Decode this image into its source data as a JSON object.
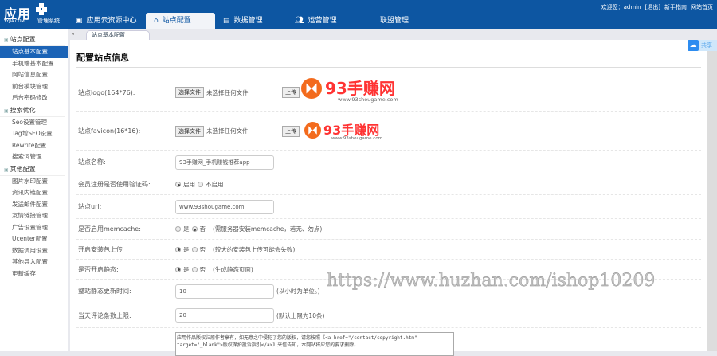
{
  "header": {
    "logo_main": "应用",
    "logo_sub": "YYJIA.COM",
    "logo_system": "管理系统",
    "nav": [
      {
        "label": "应用云资源中心",
        "icon": "window-icon"
      },
      {
        "label": "站点配置",
        "icon": "home-icon",
        "active": true
      },
      {
        "label": "数据管理",
        "icon": "table-icon"
      },
      {
        "label": "运营管理",
        "icon": "users-icon"
      },
      {
        "label": "联盟管理"
      }
    ],
    "welcome": "欢迎您：admin",
    "logout": "[退出]",
    "guide": "新手指南",
    "home": "网站首页"
  },
  "sidebar": {
    "groups": [
      {
        "title": "站点配置",
        "items": [
          "站点基本配置",
          "手机端基本配置",
          "网站信息配置",
          "前台模块管理",
          "后台密码修改"
        ]
      },
      {
        "title": "搜索优化",
        "items": [
          "Seo设置管理",
          "Tag增SEO设置",
          "Rewrite配置",
          "搜索词管理"
        ]
      },
      {
        "title": "其他配置",
        "items": [
          "图片水印配置",
          "资讯内链配置",
          "发送邮件配置",
          "友情链接管理",
          "广告设置管理",
          "Ucenter配置",
          "数据调用设置",
          "其他导入配置",
          "更新缓存"
        ]
      }
    ],
    "selected": "站点基本配置"
  },
  "tab": "站点基本配置",
  "cloud_label": "共享",
  "page_title": "配置站点信息",
  "brand": {
    "name": "93手赚网",
    "url": "www.93shougame.com",
    "color": "#f36b1d"
  },
  "form": {
    "logo": {
      "label": "站点logo(164*76):",
      "choose": "选择文件",
      "none": "未选择任何文件",
      "upload": "上传"
    },
    "favicon": {
      "label": "站点favicon(16*16):",
      "choose": "选择文件",
      "none": "未选择任何文件",
      "upload": "上传"
    },
    "site_name": {
      "label": "站点名称:",
      "value": "93手赚网_手机赚钱推荐app"
    },
    "captcha": {
      "label": "会员注册是否使用验证码:",
      "opt1": "启用",
      "opt2": "不启用"
    },
    "site_url": {
      "label": "站点url:",
      "value": "www.93shougame.com"
    },
    "memcache": {
      "label": "是否启用memcache:",
      "opt1": "是",
      "opt2": "否",
      "note": "(需服务器安装memcache，若无、勿点)"
    },
    "pkg_upload": {
      "label": "开启安装包上传",
      "opt1": "是",
      "opt2": "否",
      "note": "(较大的安装包上传可能会失败)"
    },
    "static": {
      "label": "是否开启静态:",
      "opt1": "是",
      "opt2": "否",
      "note": "(生成静态页面)"
    },
    "static_time": {
      "label": "整站静态更新时间:",
      "value": "10",
      "note": "(以小时为单位。)"
    },
    "comment_limit": {
      "label": "当天评论条数上限:",
      "value": "20",
      "note": "(默认上限为10条)"
    },
    "copyright": "应用作品版权归原作者享有，如无意之中侵犯了您的版权，请您按照《<a href=\"/contact/copyright.htm\" target=\"_blank\">版权保护投诉指引</a>》来信告知，本网站将应您的要求删除。"
  },
  "watermark": "https://www.huzhan.com/ishop10209"
}
